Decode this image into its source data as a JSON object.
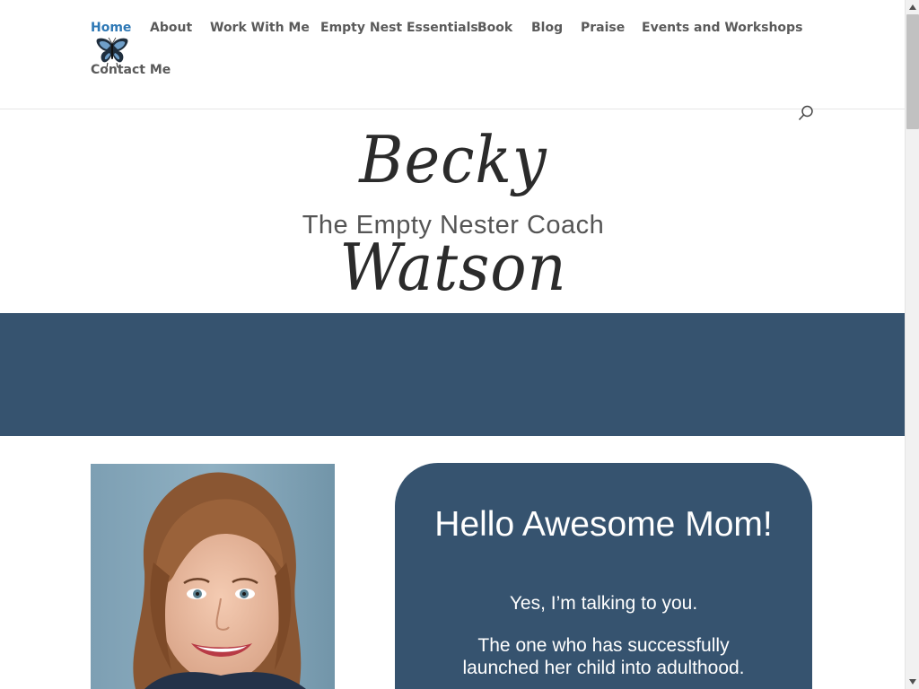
{
  "nav": {
    "items": [
      {
        "label": "Home",
        "active": true
      },
      {
        "label": "About",
        "active": false
      },
      {
        "label": "Work With Me",
        "active": false
      },
      {
        "label": "Empty Nest Essentials",
        "active": false
      },
      {
        "label": "Book",
        "active": false
      },
      {
        "label": "Blog",
        "active": false
      },
      {
        "label": "Praise",
        "active": false
      },
      {
        "label": "Events and Workshops",
        "active": false
      },
      {
        "label": "Contact Me",
        "active": false
      }
    ],
    "logo_icon": "butterfly-icon",
    "search_icon": "search-icon"
  },
  "branding": {
    "name": "Becky Watson",
    "tagline": "The Empty Nester Coach"
  },
  "welcome": {
    "title": "Hello Awesome Mom!",
    "line1": "Yes, I’m talking to you.",
    "line2": "The one who has successfully launched her child into adulthood."
  },
  "colors": {
    "nav_active": "#2e78b5",
    "nav_text": "#5a5a5a",
    "banner": "#36536f",
    "card": "#36536f",
    "card_text": "#ffffff"
  }
}
